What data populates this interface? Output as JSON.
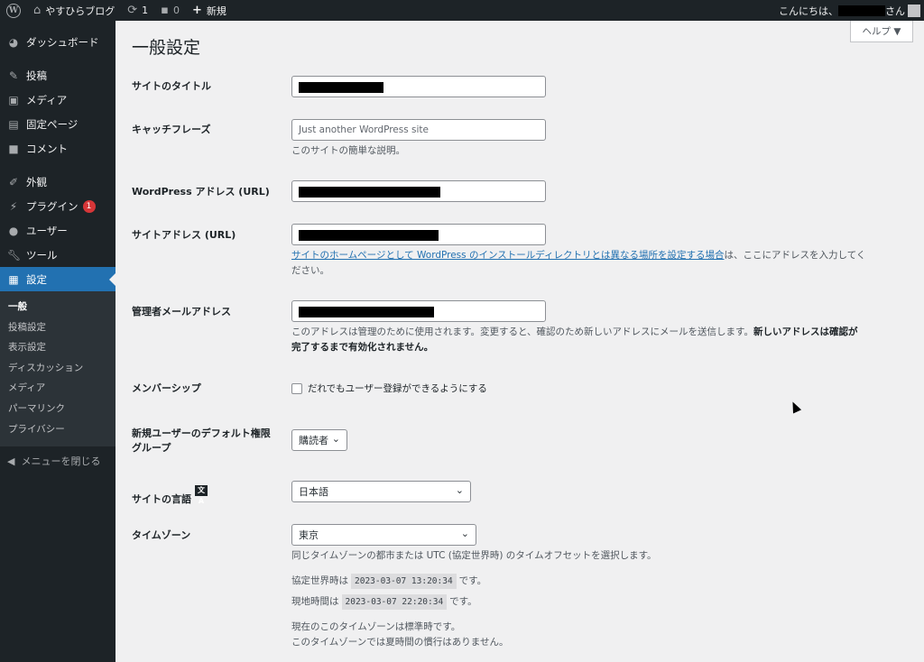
{
  "adminbar": {
    "site_name": "やすひらブログ",
    "updates_count": "1",
    "comments_count": "0",
    "new_label": "新規",
    "greeting": "こんにちは、",
    "greeting_suffix": "さん"
  },
  "sidebar": {
    "items": [
      {
        "label": "ダッシュボード",
        "icon": "dashboard-icon"
      },
      {
        "label": "投稿",
        "icon": "pin-icon"
      },
      {
        "label": "メディア",
        "icon": "media-icon"
      },
      {
        "label": "固定ページ",
        "icon": "page-icon"
      },
      {
        "label": "コメント",
        "icon": "comment-icon"
      },
      {
        "label": "外観",
        "icon": "brush-icon"
      },
      {
        "label": "プラグイン",
        "icon": "plugin-icon",
        "badge": "1"
      },
      {
        "label": "ユーザー",
        "icon": "user-icon"
      },
      {
        "label": "ツール",
        "icon": "wrench-icon"
      },
      {
        "label": "設定",
        "icon": "settings-icon"
      }
    ],
    "submenu": [
      "一般",
      "投稿設定",
      "表示設定",
      "ディスカッション",
      "メディア",
      "パーマリンク",
      "プライバシー"
    ],
    "collapse_label": "メニューを閉じる"
  },
  "help_label": "ヘルプ ▼",
  "page_title": "一般設定",
  "fields": {
    "site_title_label": "サイトのタイトル",
    "tagline_label": "キャッチフレーズ",
    "tagline_placeholder": "Just another WordPress site",
    "tagline_desc": "このサイトの簡単な説明。",
    "wp_url_label": "WordPress アドレス (URL)",
    "site_url_label": "サイトアドレス (URL)",
    "site_url_link": "サイトのホームページとして WordPress のインストールディレクトリとは異なる場所を設定する場合",
    "site_url_desc_1": "は、ここにアドレスを入力してく",
    "site_url_desc_2": "ださい。",
    "admin_email_label": "管理者メールアドレス",
    "admin_email_desc": "このアドレスは管理のために使用されます。変更すると、確認のため新しいアドレスにメールを送信します。",
    "admin_email_strong_1": "新しいアドレスは確認が",
    "admin_email_strong_2": "完了するまで有効化されません。",
    "membership_label": "メンバーシップ",
    "membership_checkbox": "だれでもユーザー登録ができるようにする",
    "membership_checked": false,
    "default_role_label_1": "新規ユーザーのデフォルト権限",
    "default_role_label_2": "グループ",
    "default_role_value": "購読者",
    "language_label": "サイトの言語",
    "language_value": "日本語",
    "timezone_label": "タイムゾーン",
    "timezone_value": "東京",
    "timezone_desc": "同じタイムゾーンの都市または UTC (協定世界時) のタイムオフセットを選択します。",
    "utc_label": "協定世界時は",
    "utc_time": "2023-03-07 13:20:34",
    "local_label": "現地時間は",
    "local_time": "2023-03-07 22:20:34",
    "time_suffix": "です。",
    "dst_line_1": "現在のこのタイムゾーンは標準時です。",
    "dst_line_2": "このタイムゾーンでは夏時間の慣行はありません。"
  },
  "colors": {
    "accent": "#2271b1",
    "sidebar_bg": "#1d2327",
    "badge": "#d63638",
    "page_bg": "#f0f0f1"
  }
}
